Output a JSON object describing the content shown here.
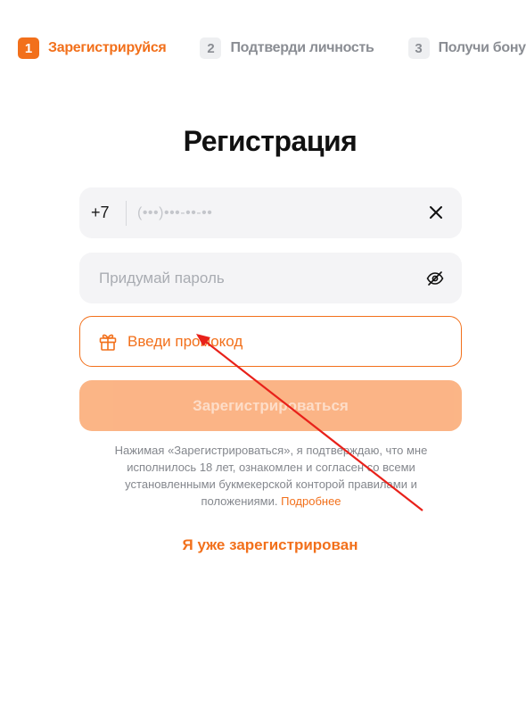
{
  "steps": [
    {
      "number": "1",
      "label": "Зарегистрируйся"
    },
    {
      "number": "2",
      "label": "Подтверди личность"
    },
    {
      "number": "3",
      "label": "Получи бонус"
    }
  ],
  "title": "Регистрация",
  "phone": {
    "prefix": "+7",
    "placeholder": "(•••)•••-••-••"
  },
  "password": {
    "placeholder": "Придумай пароль"
  },
  "promo": {
    "label": "Введи промокод"
  },
  "submit_label": "Зарегистрироваться",
  "disclaimer": {
    "text": "Нажимая «Зарегистрироваться», я подтверждаю, что мне исполнилось 18 лет, ознакомлен и согласен со всеми установленными букмекерской конторой правилами и положениями. ",
    "link": "Подробнее"
  },
  "already_registered": "Я уже зарегистрирован",
  "icons": {
    "clear": "close-icon",
    "eye": "eye-hidden-icon",
    "gift": "gift-icon"
  },
  "colors": {
    "accent": "#f2701b",
    "button_disabled": "#fbb180",
    "field_bg": "#f4f4f6",
    "annotation_arrow": "#e8211a"
  }
}
